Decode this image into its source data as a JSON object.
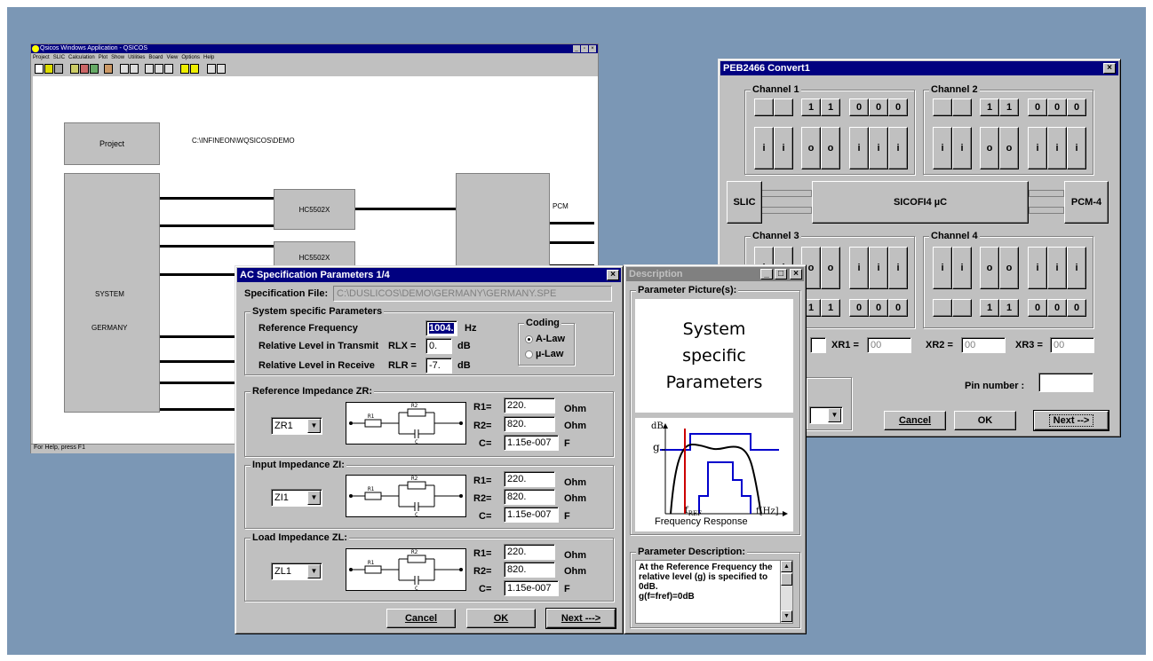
{
  "qsicos": {
    "title": "Qsicos Windows Application - QSICOS",
    "menu": [
      "Project",
      "SLIC",
      "Calculation",
      "Plot",
      "Show",
      "Utilities",
      "Board",
      "View",
      "Options",
      "Help"
    ],
    "project_button": "Project",
    "project_path": "C:\\INFINEON\\WQSICOS\\DEMO",
    "hc1": "HC5502X",
    "hc2": "HC5502X",
    "pcm": "PCM",
    "system": "SYSTEM",
    "country": "GERMANY",
    "status": "For Help, press F1"
  },
  "peb": {
    "title": "PEB2466 Convert1",
    "channel1": "Channel 1",
    "channel2": "Channel 2",
    "channel3": "Channel 3",
    "channel4": "Channel 4",
    "top_pins": [
      "",
      "",
      "1",
      "1",
      "0",
      "0",
      "0"
    ],
    "io_pins": [
      "i",
      "i",
      "o",
      "o",
      "i",
      "i",
      "i"
    ],
    "slic": "SLIC",
    "sicofi": "SICOFI4 µC",
    "pcm4": "PCM-4",
    "xr1_label": "XR1 =",
    "xr1": "00",
    "xr2_label": "XR2 =",
    "xr2": "00",
    "xr3_label": "XR3 =",
    "xr3": "00",
    "pin_number": "Pin number :",
    "cancel": "Cancel",
    "ok": "OK",
    "next": "Next -->"
  },
  "ac": {
    "title": "AC Specification Parameters 1/4",
    "spec_file_label": "Specification File:",
    "spec_file": "C:\\DUSLICOS\\DEMO\\GERMANY\\GERMANY.SPE",
    "sys_group": "System specific Parameters",
    "ref_freq_label": "Reference Frequency",
    "ref_freq": "1004.",
    "ref_freq_unit": "Hz",
    "rlx_label": "Relative Level in Transmit",
    "rlx_sym": "RLX =",
    "rlx": "0.",
    "rlx_unit": "dB",
    "rlr_label": "Relative Level in Receive",
    "rlr_sym": "RLR =",
    "rlr": "-7.",
    "rlr_unit": "dB",
    "coding": "Coding",
    "alaw": "A-Law",
    "ulaw": "µ-Law",
    "zr_group": "Reference Impedance ZR:",
    "zr_sel": "ZR1",
    "zi_group": "Input Impedance ZI:",
    "zi_sel": "ZI1",
    "zl_group": "Load Impedance ZL:",
    "zl_sel": "ZL1",
    "r1_label": "R1=",
    "r2_label": "R2=",
    "c_label": "C=",
    "r1": "220.",
    "r2": "820.",
    "c": "1.15e-007",
    "ohm": "Ohm",
    "farad": "F",
    "cancel": "Cancel",
    "ok": "OK",
    "next": "Next --->"
  },
  "desc": {
    "title": "Description",
    "pic_group": "Parameter Picture(s):",
    "pic_line1": "System",
    "pic_line2": "specific",
    "pic_line3": "Parameters",
    "graph_db": "dB",
    "graph_g": "g",
    "graph_fref": "f",
    "graph_fref_sub": "REF",
    "graph_fhz": "f[Hz]",
    "graph_caption": "Frequency Response",
    "desc_group": "Parameter Description:",
    "desc_text": "At the Reference Frequency the relative level (g) is specified to 0dB.\ng(f=fref)=0dB"
  }
}
